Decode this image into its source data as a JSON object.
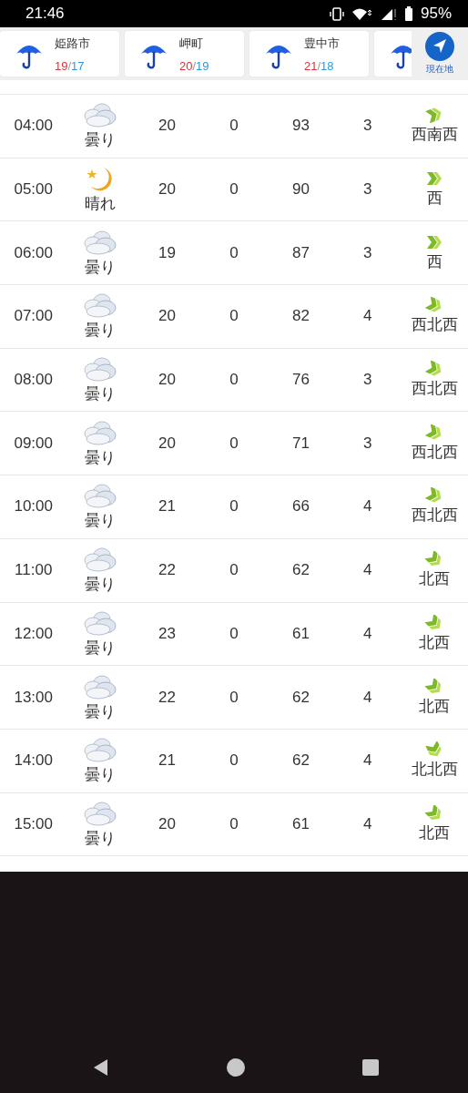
{
  "status_bar": {
    "time": "21:46",
    "battery": "95%"
  },
  "locations": [
    {
      "kind": "rain",
      "name": "姫路市",
      "high": "19",
      "separator": "/",
      "low": "17"
    },
    {
      "kind": "rain",
      "name": "岬町",
      "high": "20",
      "separator": "/",
      "low": "19"
    },
    {
      "kind": "rain",
      "name": "豊中市",
      "high": "21",
      "separator": "/",
      "low": "18"
    },
    {
      "kind": "rain"
    }
  ],
  "current_location_button": {
    "label": "現在地"
  },
  "forecast_rows": [
    {
      "time": "04:00",
      "kind": "cloudy",
      "weather": "曇り",
      "temperature": "20",
      "precipitation": "0",
      "humidity": "93",
      "wind_speed": "3",
      "wind": {
        "kind": "east-northeast",
        "direction": "西南西"
      }
    },
    {
      "time": "05:00",
      "kind": "clear-night",
      "weather": "晴れ",
      "temperature": "20",
      "precipitation": "0",
      "humidity": "90",
      "wind_speed": "3",
      "wind": {
        "kind": "east",
        "direction": "西"
      }
    },
    {
      "time": "06:00",
      "kind": "cloudy",
      "weather": "曇り",
      "temperature": "19",
      "precipitation": "0",
      "humidity": "87",
      "wind_speed": "3",
      "wind": {
        "kind": "east",
        "direction": "西"
      }
    },
    {
      "time": "07:00",
      "kind": "cloudy",
      "weather": "曇り",
      "temperature": "20",
      "precipitation": "0",
      "humidity": "82",
      "wind_speed": "4",
      "wind": {
        "kind": "east-southeast",
        "direction": "西北西"
      }
    },
    {
      "time": "08:00",
      "kind": "cloudy",
      "weather": "曇り",
      "temperature": "20",
      "precipitation": "0",
      "humidity": "76",
      "wind_speed": "3",
      "wind": {
        "kind": "east-southeast",
        "direction": "西北西"
      }
    },
    {
      "time": "09:00",
      "kind": "cloudy",
      "weather": "曇り",
      "temperature": "20",
      "precipitation": "0",
      "humidity": "71",
      "wind_speed": "3",
      "wind": {
        "kind": "east-southeast",
        "direction": "西北西"
      }
    },
    {
      "time": "10:00",
      "kind": "cloudy",
      "weather": "曇り",
      "temperature": "21",
      "precipitation": "0",
      "humidity": "66",
      "wind_speed": "4",
      "wind": {
        "kind": "east-southeast",
        "direction": "西北西"
      }
    },
    {
      "time": "11:00",
      "kind": "cloudy",
      "weather": "曇り",
      "temperature": "22",
      "precipitation": "0",
      "humidity": "62",
      "wind_speed": "4",
      "wind": {
        "kind": "southeast",
        "direction": "北西"
      }
    },
    {
      "time": "12:00",
      "kind": "cloudy",
      "weather": "曇り",
      "temperature": "23",
      "precipitation": "0",
      "humidity": "61",
      "wind_speed": "4",
      "wind": {
        "kind": "southeast",
        "direction": "北西"
      }
    },
    {
      "time": "13:00",
      "kind": "cloudy",
      "weather": "曇り",
      "temperature": "22",
      "precipitation": "0",
      "humidity": "62",
      "wind_speed": "4",
      "wind": {
        "kind": "southeast",
        "direction": "北西"
      }
    },
    {
      "time": "14:00",
      "kind": "cloudy",
      "weather": "曇り",
      "temperature": "21",
      "precipitation": "0",
      "humidity": "62",
      "wind_speed": "4",
      "wind": {
        "kind": "south-southeast",
        "direction": "北北西"
      }
    },
    {
      "time": "15:00",
      "kind": "cloudy",
      "weather": "曇り",
      "temperature": "20",
      "precipitation": "0",
      "humidity": "61",
      "wind_speed": "4",
      "wind": {
        "kind": "southeast",
        "direction": "北西"
      }
    }
  ]
}
